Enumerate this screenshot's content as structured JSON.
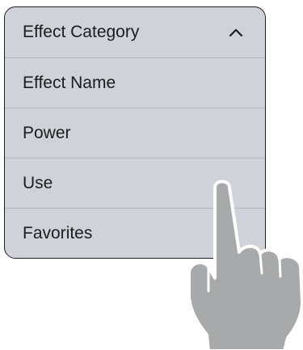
{
  "menu": {
    "header": {
      "label": "Effect Category",
      "icon": "chevron-up-icon"
    },
    "items": [
      {
        "label": "Effect Name"
      },
      {
        "label": "Power"
      },
      {
        "label": "Use"
      },
      {
        "label": "Favorites"
      }
    ]
  },
  "colors": {
    "menu_background": "#cfd2d8",
    "menu_border": "#1f1f1f",
    "separator": "#b3b6bd",
    "text": "#1c1c1e",
    "hand_fill": "#a7a9aa",
    "hand_outline": "#ffffff"
  },
  "overlay": {
    "icon": "pointing-hand-icon"
  }
}
